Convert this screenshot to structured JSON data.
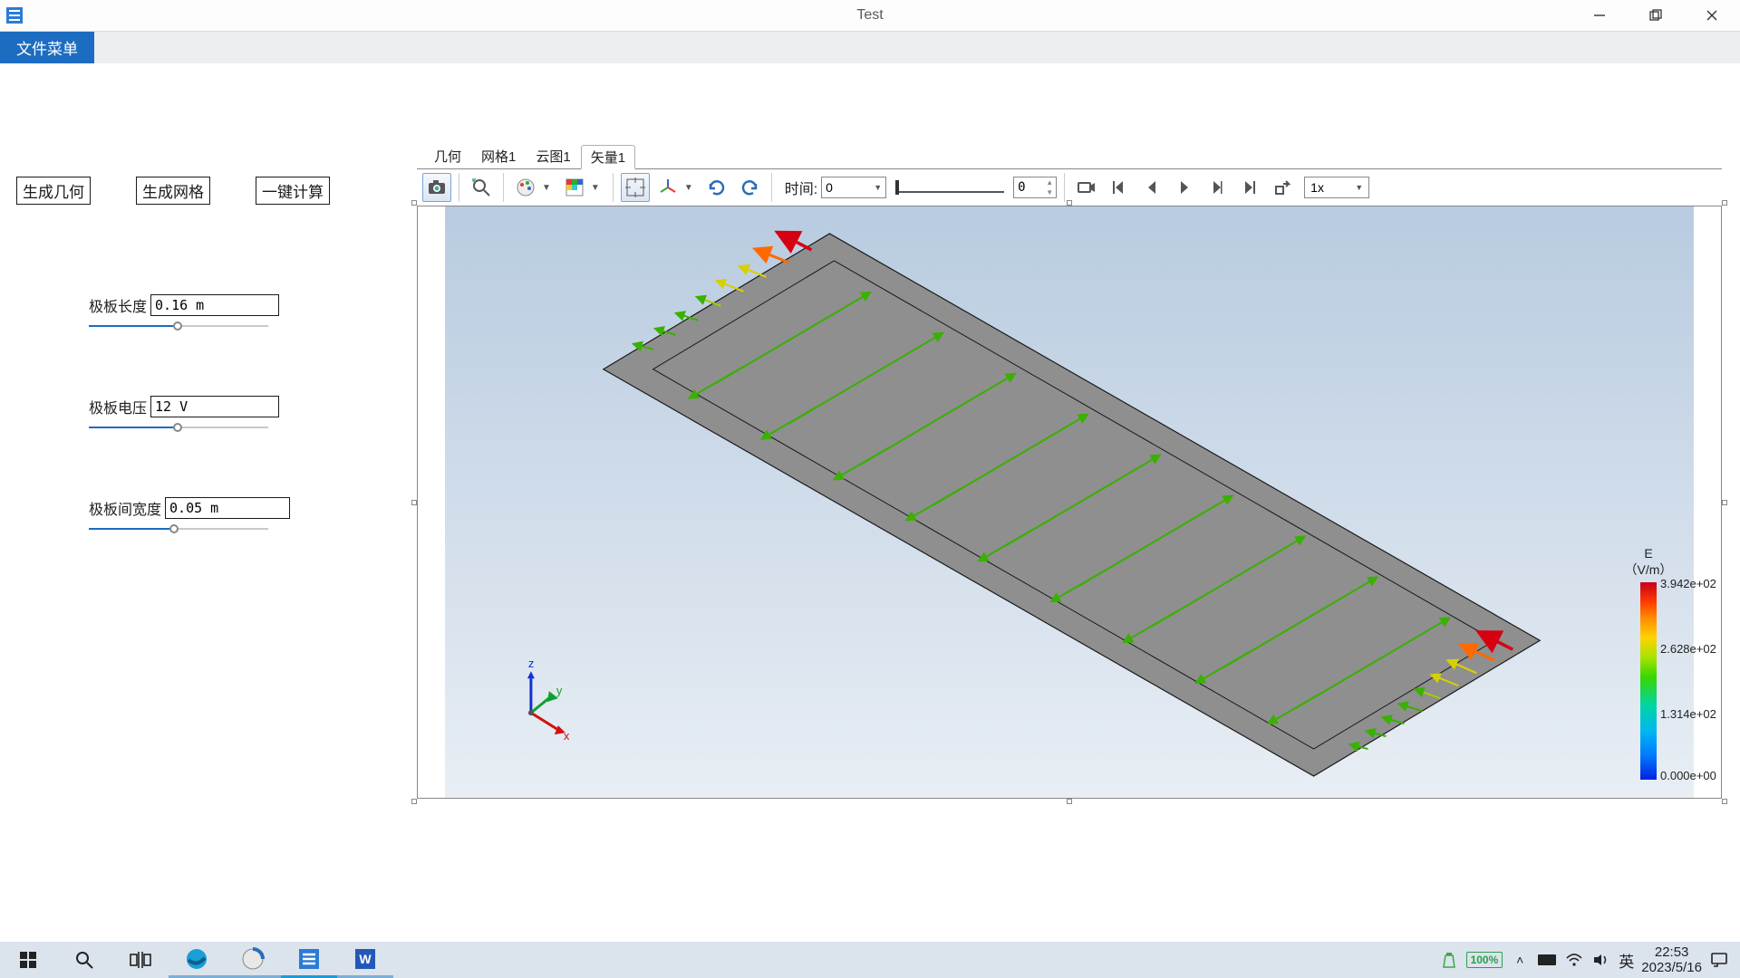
{
  "window": {
    "title": "Test",
    "menu": {
      "file": "文件菜单"
    }
  },
  "buttons": {
    "gen_geometry": "生成几何",
    "gen_mesh": "生成网格",
    "one_click_calc": "一键计算"
  },
  "params": {
    "length": {
      "label": "极板长度",
      "value": "0.16 m",
      "slider_pos": 0.5
    },
    "voltage": {
      "label": "极板电压",
      "value": "12 V",
      "slider_pos": 0.5
    },
    "gap": {
      "label": "极板间宽度",
      "value": "0.05 m",
      "slider_pos": 0.48
    }
  },
  "tabs": {
    "items": [
      "几何",
      "网格1",
      "云图1",
      "矢量1"
    ],
    "active_index": 3
  },
  "toolbar": {
    "time_label": "时间:",
    "time_value": "0",
    "frame_value": "0",
    "speed_value": "1x"
  },
  "legend": {
    "title": "E",
    "unit": "（V/m）",
    "ticks": {
      "t0": "3.942e+02",
      "t1": "2.628e+02",
      "t2": "1.314e+02",
      "t3": "0.000e+00"
    }
  },
  "taskbar": {
    "battery": "100%",
    "ime": "英",
    "time": "22:53",
    "date": "2023/5/16"
  }
}
